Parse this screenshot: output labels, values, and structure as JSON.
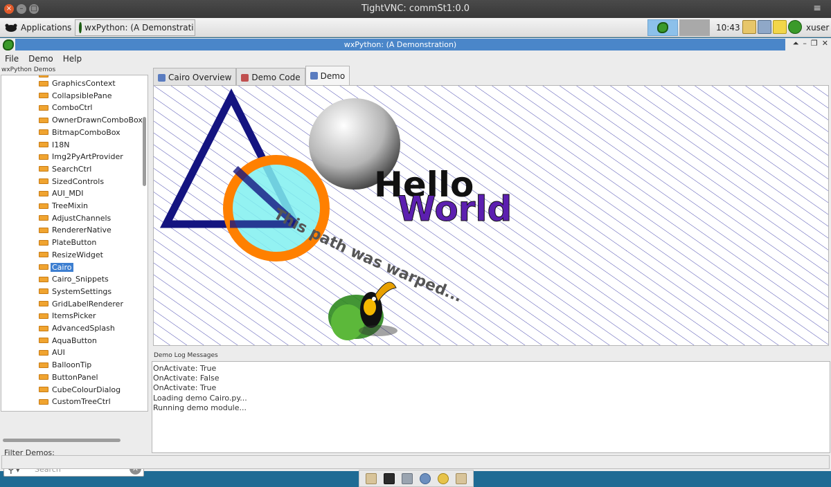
{
  "vnc": {
    "title": "TightVNC: commSt1:0.0",
    "close": "×",
    "min": "–",
    "max": "□",
    "menu": "≡"
  },
  "panel": {
    "apps_label": "Applications",
    "task_label": "wxPython: (A Demonstrati...",
    "clock": "10:43",
    "user": "xuser"
  },
  "app": {
    "title": "wxPython: (A Demonstration)",
    "window_controls": [
      "⏶",
      "–",
      "❐",
      "✕"
    ],
    "menu": [
      "File",
      "Demo",
      "Help"
    ]
  },
  "tree": {
    "caption": "wxPython Demos",
    "items": [
      "GraphicsContext",
      "CollapsiblePane",
      "ComboCtrl",
      "OwnerDrawnComboBox",
      "BitmapComboBox",
      "I18N",
      "Img2PyArtProvider",
      "SearchCtrl",
      "SizedControls",
      "AUI_MDI",
      "TreeMixin",
      "AdjustChannels",
      "RendererNative",
      "PlateButton",
      "ResizeWidget",
      "Cairo",
      "Cairo_Snippets",
      "SystemSettings",
      "GridLabelRenderer",
      "ItemsPicker",
      "AdvancedSplash",
      "AquaButton",
      "AUI",
      "BalloonTip",
      "ButtonPanel",
      "CubeColourDialog",
      "CustomTreeCtrl"
    ],
    "selected": "Cairo"
  },
  "filter": {
    "label": "Filter Demos:",
    "placeholder": "Search",
    "clear": "✕",
    "search_icon": "⚲▾"
  },
  "tabs": [
    {
      "label": "Cairo Overview",
      "icon": "info-icon"
    },
    {
      "label": "Demo Code",
      "icon": "code-icon"
    },
    {
      "label": "Demo",
      "icon": "demo-icon"
    }
  ],
  "canvas": {
    "hello": "Hello",
    "world": "World",
    "warped": "This path was warped...",
    "colors": {
      "triangle": "#141480",
      "ring": "#ff8000",
      "fill": "#80f0f0",
      "world": "#5c1fb0",
      "hatch": "#4b4bb0"
    }
  },
  "log": {
    "caption": "Demo Log Messages",
    "lines": [
      "OnActivate: True",
      "OnActivate: False",
      "OnActivate: True",
      "Loading demo Cairo.py...",
      "Running demo module..."
    ]
  }
}
